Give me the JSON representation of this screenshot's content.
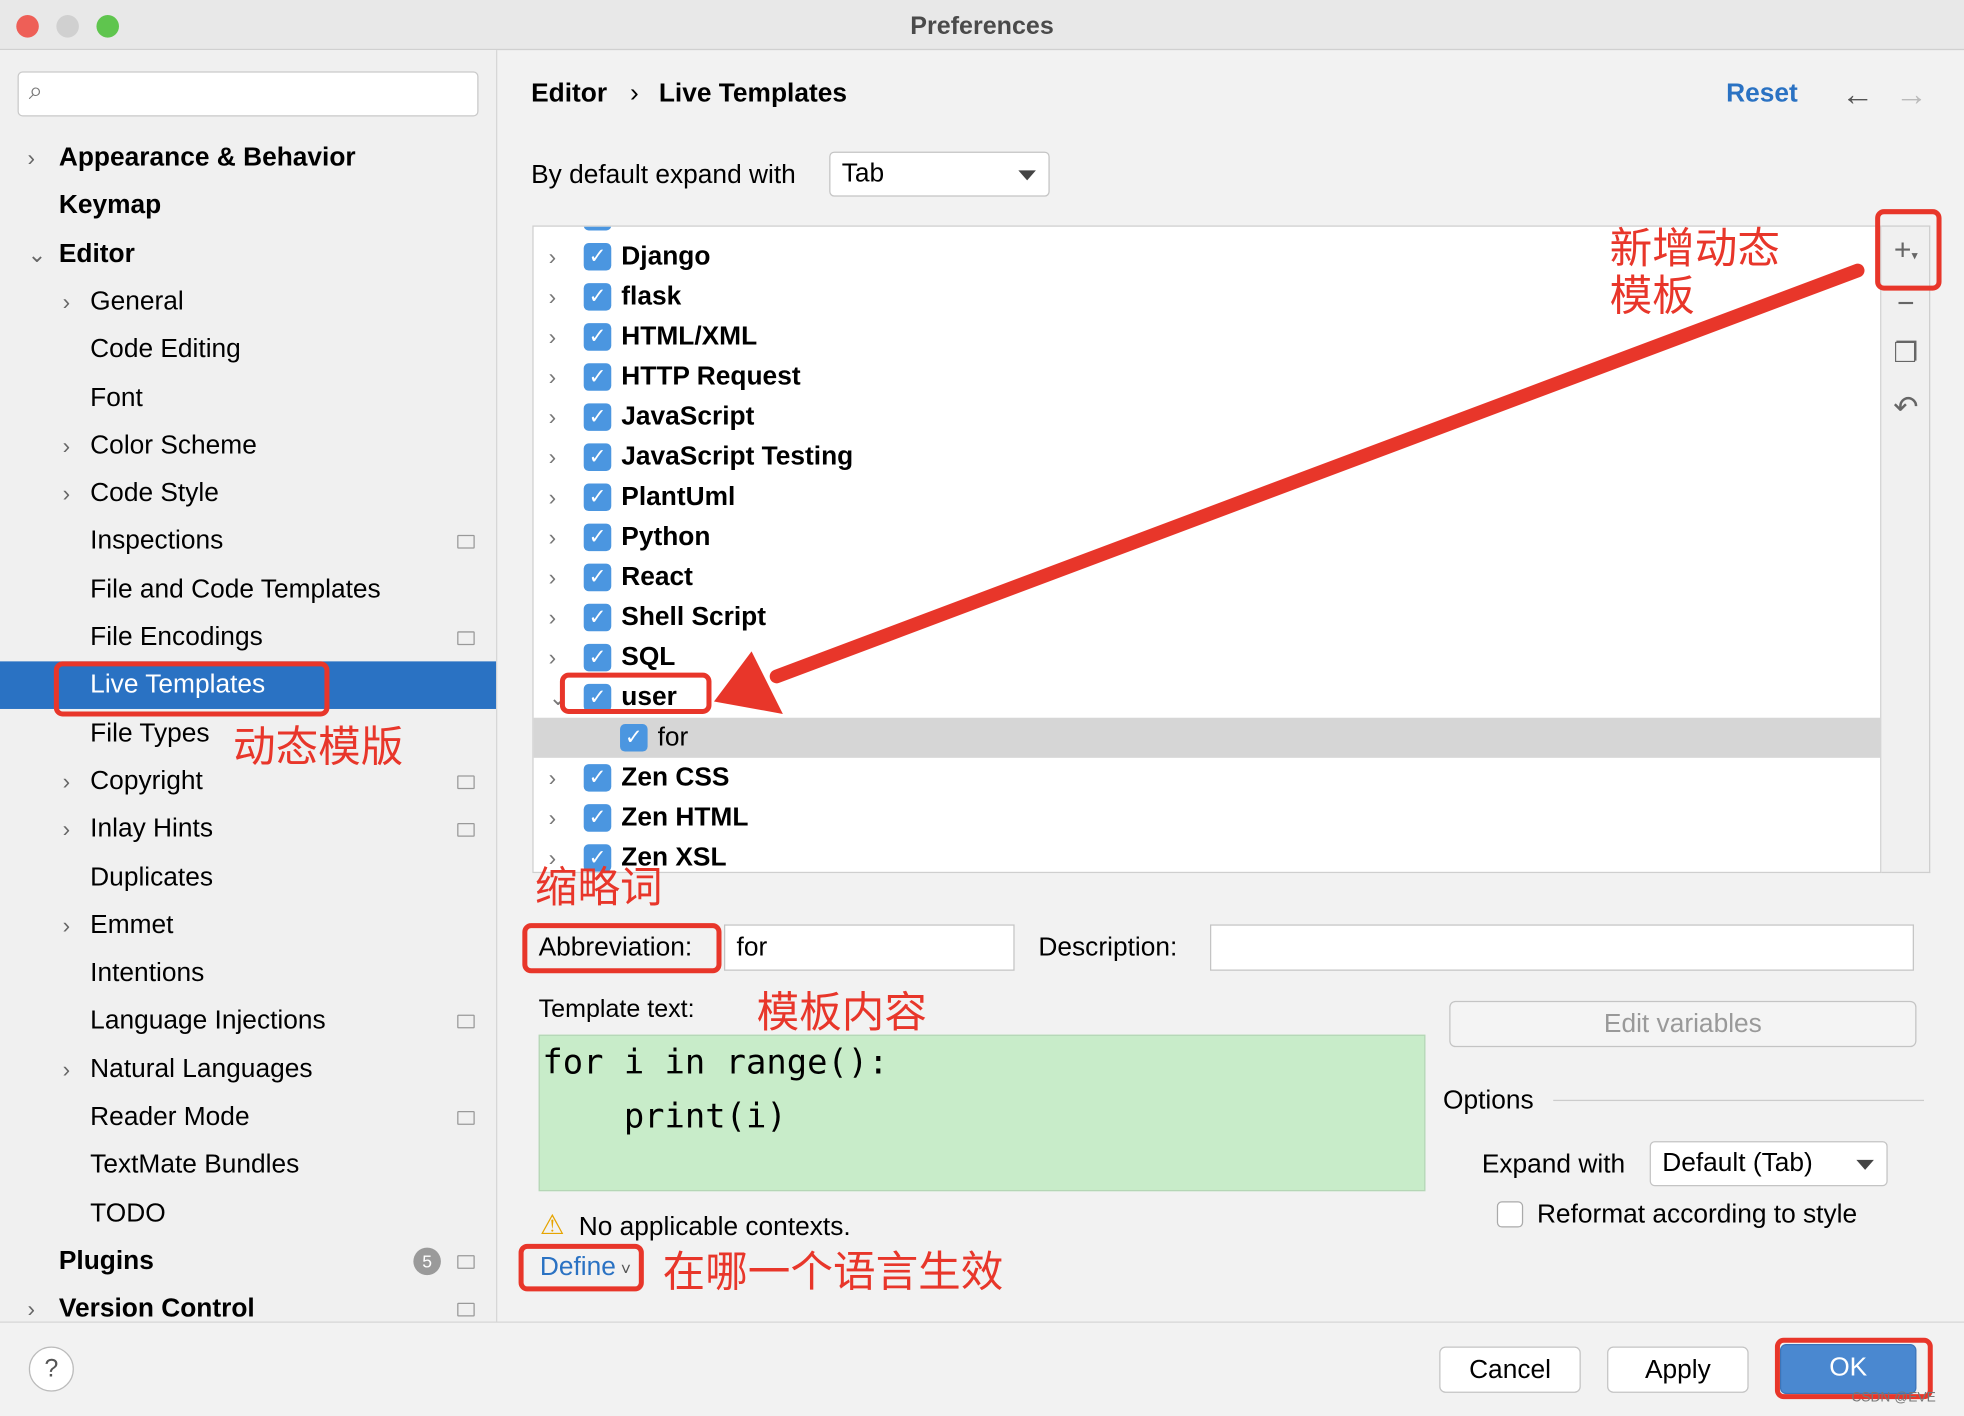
{
  "window": {
    "title": "Preferences"
  },
  "sidebar": {
    "search_placeholder": "",
    "items": [
      {
        "label": "Appearance & Behavior",
        "level": 0,
        "chevron": "right"
      },
      {
        "label": "Keymap",
        "level": 0
      },
      {
        "label": "Editor",
        "level": 0,
        "chevron": "down"
      },
      {
        "label": "General",
        "level": 1,
        "chevron": "right"
      },
      {
        "label": "Code Editing",
        "level": 1
      },
      {
        "label": "Font",
        "level": 1
      },
      {
        "label": "Color Scheme",
        "level": 1,
        "chevron": "right"
      },
      {
        "label": "Code Style",
        "level": 1,
        "chevron": "right"
      },
      {
        "label": "Inspections",
        "level": 1,
        "icon": true
      },
      {
        "label": "File and Code Templates",
        "level": 1
      },
      {
        "label": "File Encodings",
        "level": 1,
        "icon": true
      },
      {
        "label": "Live Templates",
        "level": 1,
        "selected": true
      },
      {
        "label": "File Types",
        "level": 1
      },
      {
        "label": "Copyright",
        "level": 1,
        "chevron": "right",
        "icon": true
      },
      {
        "label": "Inlay Hints",
        "level": 1,
        "chevron": "right",
        "icon": true
      },
      {
        "label": "Duplicates",
        "level": 1
      },
      {
        "label": "Emmet",
        "level": 1,
        "chevron": "right"
      },
      {
        "label": "Intentions",
        "level": 1
      },
      {
        "label": "Language Injections",
        "level": 1,
        "icon": true
      },
      {
        "label": "Natural Languages",
        "level": 1,
        "chevron": "right"
      },
      {
        "label": "Reader Mode",
        "level": 1,
        "icon": true
      },
      {
        "label": "TextMate Bundles",
        "level": 1
      },
      {
        "label": "TODO",
        "level": 1
      },
      {
        "label": "Plugins",
        "level": 0,
        "badge": "5",
        "icon": true
      },
      {
        "label": "Version Control",
        "level": 0,
        "chevron": "right",
        "icon": true
      }
    ]
  },
  "header": {
    "breadcrumb": [
      "Editor",
      "Live Templates"
    ],
    "reset": "Reset"
  },
  "expand_default": {
    "label": "By default expand with",
    "value": "Tab"
  },
  "templates": [
    {
      "label": "",
      "partial": true
    },
    {
      "label": "Django",
      "checked": true
    },
    {
      "label": "flask",
      "checked": true
    },
    {
      "label": "HTML/XML",
      "checked": true
    },
    {
      "label": "HTTP Request",
      "checked": true
    },
    {
      "label": "JavaScript",
      "checked": true
    },
    {
      "label": "JavaScript Testing",
      "checked": true
    },
    {
      "label": "PlantUml",
      "checked": true
    },
    {
      "label": "Python",
      "checked": true
    },
    {
      "label": "React",
      "checked": true
    },
    {
      "label": "Shell Script",
      "checked": true
    },
    {
      "label": "SQL",
      "checked": true
    },
    {
      "label": "user",
      "checked": true,
      "expanded": true
    },
    {
      "label": "for",
      "checked": true,
      "child": true,
      "selected": true
    },
    {
      "label": "Zen CSS",
      "checked": true
    },
    {
      "label": "Zen HTML",
      "checked": true
    },
    {
      "label": "Zen XSL",
      "checked": true
    }
  ],
  "toolbar": [
    "add-icon",
    "remove-icon",
    "copy-icon",
    "restore-icon"
  ],
  "editor": {
    "abbreviation_label": "Abbreviation:",
    "abbreviation": "for",
    "description_label": "Description:",
    "description": "",
    "template_text_label": "Template text:",
    "template_text": "for i in range():\n    print(i)",
    "edit_variables": "Edit variables",
    "options_label": "Options",
    "expand_with_label": "Expand with",
    "expand_with": "Default (Tab)",
    "reformat_label": "Reformat according to style",
    "reformat_checked": false,
    "warning": "No applicable contexts.",
    "define": "Define"
  },
  "buttons": {
    "help": "?",
    "cancel": "Cancel",
    "apply": "Apply",
    "ok": "OK"
  },
  "annotations": {
    "live_templates": "动态模版",
    "add": "新增动态\n模板",
    "abbreviation": "缩略词",
    "template_text": "模板内容",
    "define": "在哪一个语言生效",
    "color": "#e8362a"
  },
  "watermark": "CSDN @EVE"
}
